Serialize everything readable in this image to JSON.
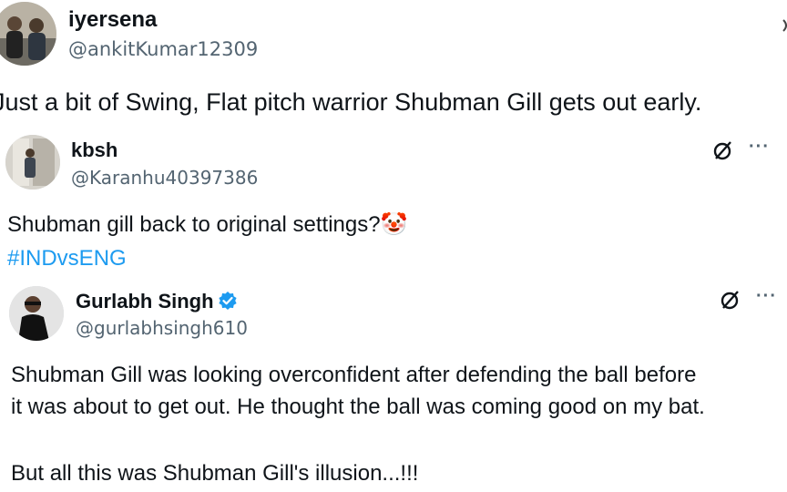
{
  "post1": {
    "display_name": "iyersena",
    "handle": "@ankitKumar12309",
    "text": "Just a bit of Swing, Flat pitch warrior Shubman Gill gets out early."
  },
  "post2": {
    "display_name": "kbsh",
    "handle": "@Karanhu40397386",
    "text": "Shubman gill back to original settings?",
    "emoji": "🤡",
    "hashtag": "#INDvsENG"
  },
  "post3": {
    "display_name": "Gurlabh Singh",
    "handle": "@gurlabhsingh610",
    "verified": true,
    "line1": "Shubman Gill was looking overconfident after defending the ball before",
    "line2": "it was about to get out. He thought the ball was coming good on my bat.",
    "line3": "But all this was Shubman Gill's illusion...!!!"
  },
  "icons": {
    "grok": "grok-icon",
    "more": "more-icon",
    "verified": "verified-badge-icon"
  },
  "colors": {
    "link": "#1d9bf0",
    "secondary": "#536471",
    "text": "#0f1419"
  }
}
